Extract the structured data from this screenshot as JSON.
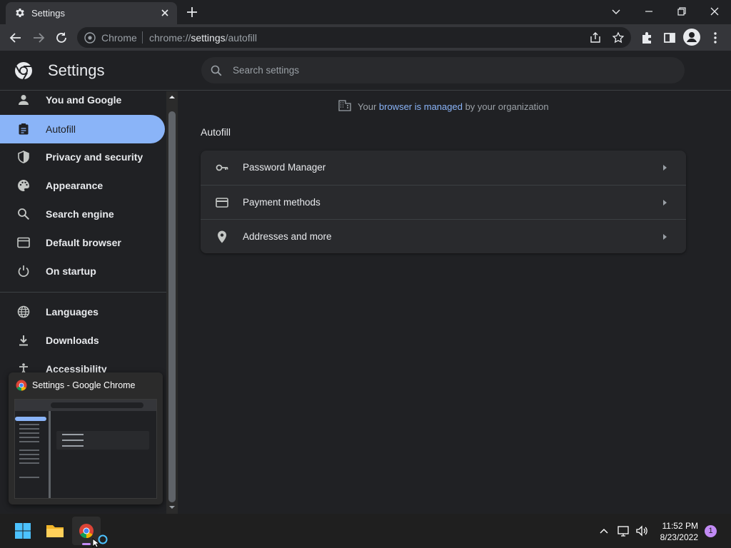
{
  "tab": {
    "title": "Settings",
    "icon": "gear-icon"
  },
  "toolbar": {
    "origin_label": "Chrome",
    "url_prefix": "chrome://",
    "url_host": "settings",
    "url_path": "/autofill"
  },
  "header": {
    "title": "Settings",
    "search_placeholder": "Search settings"
  },
  "sidebar": {
    "items": [
      {
        "label": "You and Google",
        "icon": "person-icon"
      },
      {
        "label": "Autofill",
        "icon": "clipboard-icon",
        "active": true
      },
      {
        "label": "Privacy and security",
        "icon": "shield-icon"
      },
      {
        "label": "Appearance",
        "icon": "palette-icon"
      },
      {
        "label": "Search engine",
        "icon": "search-icon"
      },
      {
        "label": "Default browser",
        "icon": "browser-window-icon"
      },
      {
        "label": "On startup",
        "icon": "power-icon"
      },
      {
        "label": "Languages",
        "icon": "globe-icon"
      },
      {
        "label": "Downloads",
        "icon": "download-icon"
      },
      {
        "label": "Accessibility",
        "icon": "accessibility-icon"
      }
    ]
  },
  "main": {
    "managed_prefix": "Your ",
    "managed_link": "browser is managed",
    "managed_suffix": " by your organization",
    "section_title": "Autofill",
    "rows": [
      {
        "label": "Password Manager",
        "icon": "key-icon"
      },
      {
        "label": "Payment methods",
        "icon": "credit-card-icon"
      },
      {
        "label": "Addresses and more",
        "icon": "location-pin-icon"
      }
    ]
  },
  "preview": {
    "title": "Settings - Google Chrome"
  },
  "taskbar": {
    "time": "11:52 PM",
    "date": "8/23/2022",
    "notification_count": "1"
  },
  "colors": {
    "accent": "#8ab4f8",
    "background": "#202124",
    "card": "#292a2d",
    "taskbar_indicator": "#c28bf5"
  }
}
